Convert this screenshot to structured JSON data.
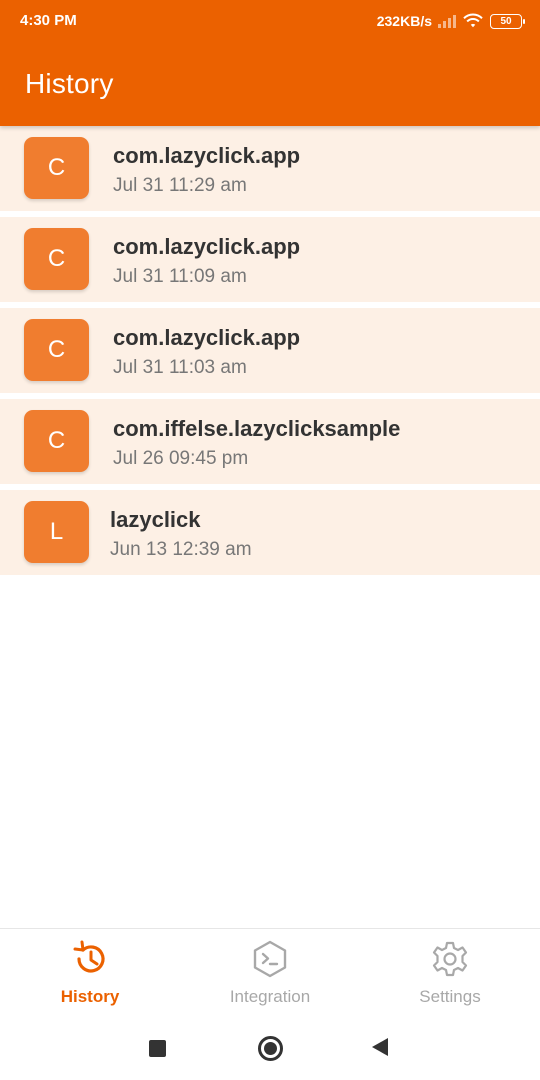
{
  "status_bar": {
    "time": "4:30 PM",
    "net_speed": "232KB/s",
    "battery": "50"
  },
  "app_bar": {
    "title": "History"
  },
  "history": [
    {
      "avatar": "C",
      "title": "com.lazyclick.app",
      "timestamp": "Jul 31 11:29 am"
    },
    {
      "avatar": "C",
      "title": "com.lazyclick.app",
      "timestamp": "Jul 31 11:09 am"
    },
    {
      "avatar": "C",
      "title": "com.lazyclick.app",
      "timestamp": "Jul 31 11:03 am"
    },
    {
      "avatar": "C",
      "title": "com.iffelse.lazyclicksample",
      "timestamp": "Jul 26 09:45 pm"
    },
    {
      "avatar": "L",
      "title": "lazyclick",
      "timestamp": "Jun 13 12:39 am"
    }
  ],
  "bottom_nav": {
    "items": [
      {
        "label": "History",
        "icon": "history-icon",
        "active": true
      },
      {
        "label": "Integration",
        "icon": "terminal-icon",
        "active": false
      },
      {
        "label": "Settings",
        "icon": "gear-icon",
        "active": false
      }
    ]
  },
  "colors": {
    "primary": "#EB6100",
    "avatar_bg": "#F07D2F",
    "row_bg": "#FDF0E5",
    "inactive": "#A8A8A8"
  }
}
